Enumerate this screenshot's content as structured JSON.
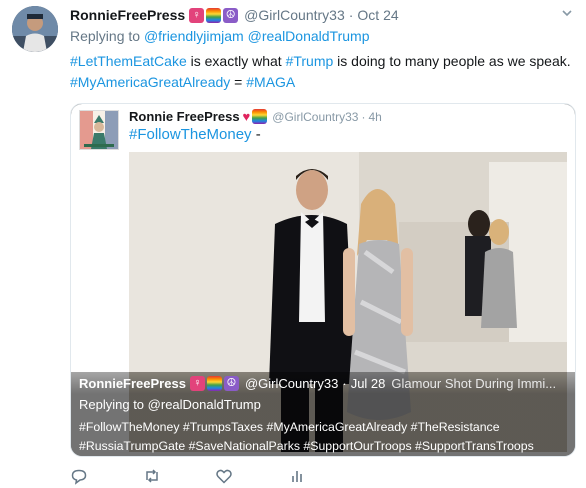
{
  "tweet": {
    "name": "RonnieFreePress",
    "handle": "@GirlCountry33",
    "separator": "·",
    "time": "Oct 24",
    "replying_prefix": "Replying to",
    "replying_user1": "@friendlyjimjam",
    "replying_user2": "@realDonaldTrump",
    "text": {
      "tag1": "#LetThemEatCake",
      "part1": " is exactly what ",
      "tag2": "#Trump",
      "part2": " is doing to many people as we speak.",
      "tag3": "#MyAmericaGreatAlready",
      "part3": " = ",
      "tag4": "#MAGA"
    }
  },
  "quoted": {
    "name": "Ronnie FreePress",
    "handle": "@GirlCountry33",
    "separator": "·",
    "time": "4h",
    "tag": "#FollowTheMoney",
    "rest": " -"
  },
  "overlay": {
    "name": "RonnieFreePress",
    "handle": "@GirlCountry33",
    "separator": "·",
    "time": "Jul 28",
    "title_fragment": "Glamour Shot During Immi...",
    "replying_prefix": "Replying to",
    "replying_user": "@realDonaldTrump",
    "tags_line1": "#FollowTheMoney #TrumpsTaxes #MyAmericaGreatAlready #TheResistance",
    "tags_line2": "#RussiaTrumpGate #SaveNationalParks #SupportOurTroops #SupportTransTroops"
  },
  "icons": {
    "reply": "reply-icon",
    "retweet": "retweet-icon",
    "like": "heart-icon",
    "analytics": "analytics-icon",
    "caret": "chevron-down-icon"
  },
  "colors": {
    "link": "#1b95e0",
    "secondary": "#657786",
    "text": "#14171a"
  }
}
